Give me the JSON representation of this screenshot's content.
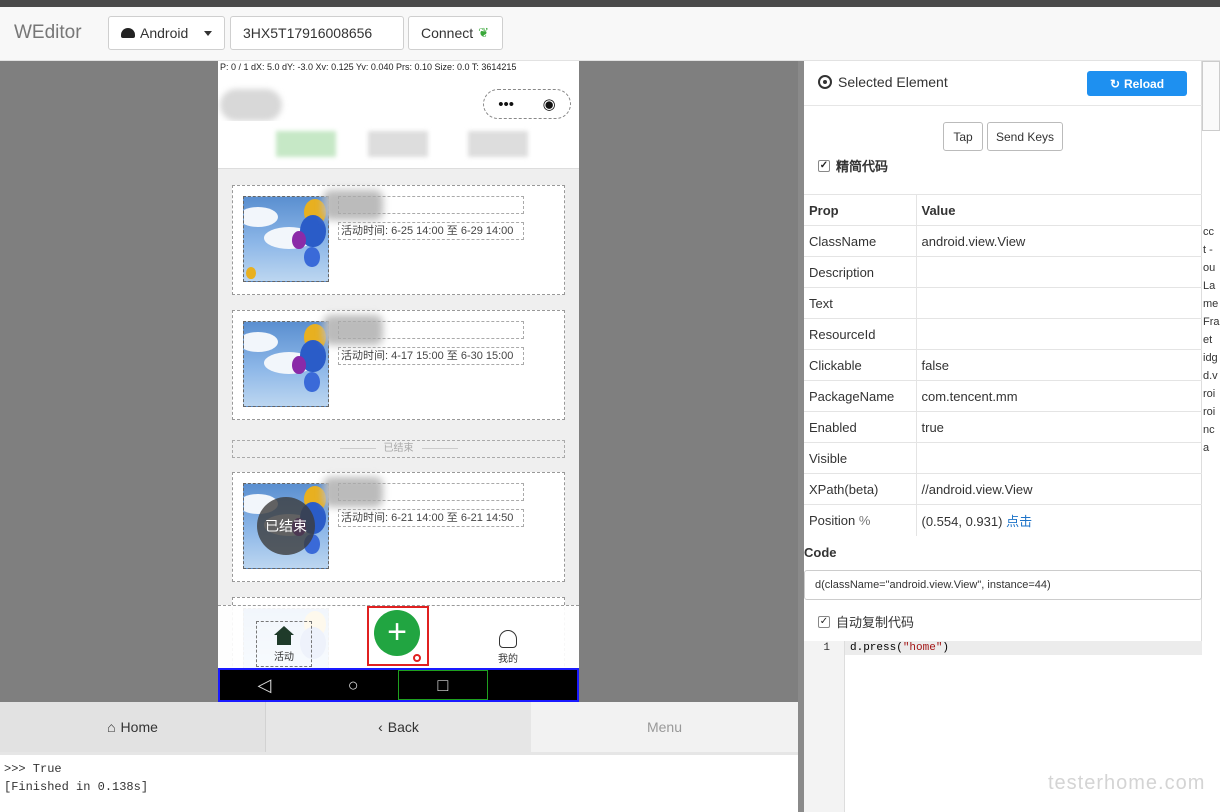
{
  "app": {
    "brand": "WEditor",
    "platform": "Android",
    "serial": "3HX5T17916008656",
    "connect_label": "Connect"
  },
  "device": {
    "statusbar_text": "P: 0 / 1  dX: 5.0  dY: -3.0  Xv: 0.125  Yv: 0.040  Prs: 0.10  Size: 0.0  T: 3614215",
    "capsule": {
      "more": "•••",
      "close": "◉"
    },
    "cards": [
      {
        "time": "活动时间: 6-25 14:00 至 6-29 14:00",
        "ended": ""
      },
      {
        "time": "活动时间: 4-17 15:00 至 6-30 15:00",
        "ended": ""
      },
      {
        "time": "活动时间: 6-21 14:00 至 6-21 14:50",
        "ended": "已结束"
      }
    ],
    "divider": "已结束",
    "nav": {
      "activity": "活动",
      "add": "+",
      "mine": "我的"
    },
    "system_nav": {
      "back": "◁",
      "home": "○",
      "recent": "□"
    }
  },
  "toolbar": {
    "home": "Home",
    "back": "Back",
    "menu": "Menu"
  },
  "console": {
    "line1": ">>> True",
    "line2": "[Finished in 0.138s]"
  },
  "watermark": "testerhome.com",
  "inspector": {
    "title": "Selected Element",
    "reload": "Reload",
    "tap": "Tap",
    "send_keys": "Send Keys",
    "simplify_label": "精简代码",
    "prop_header": "Prop",
    "value_header": "Value",
    "props": [
      {
        "name": "ClassName",
        "value": "android.view.View"
      },
      {
        "name": "Description",
        "value": ""
      },
      {
        "name": "Text",
        "value": ""
      },
      {
        "name": "ResourceId",
        "value": ""
      },
      {
        "name": "Clickable",
        "value": "false"
      },
      {
        "name": "PackageName",
        "value": "com.tencent.mm"
      },
      {
        "name": "Enabled",
        "value": "true"
      },
      {
        "name": "Visible",
        "value": ""
      },
      {
        "name": "XPath(beta)",
        "value": "//android.view.View"
      }
    ],
    "position_label": "Position",
    "position_value": "(0.554, 0.931)",
    "position_link": "点击",
    "code_label": "Code",
    "code_value": "d(className=\"android.view.View\", instance=44)",
    "auto_copy_label": "自动复制代码",
    "editor_line_no": "1",
    "editor_code_prefix": "d.press(",
    "editor_code_arg": "\"home\"",
    "editor_code_suffix": ")"
  },
  "hierarchy_fragments": [
    "cc",
    "t -",
    "ou",
    "La",
    "me",
    "Fra",
    "et",
    "idg",
    "d.v",
    "roi",
    "roi",
    "nc",
    "a"
  ]
}
